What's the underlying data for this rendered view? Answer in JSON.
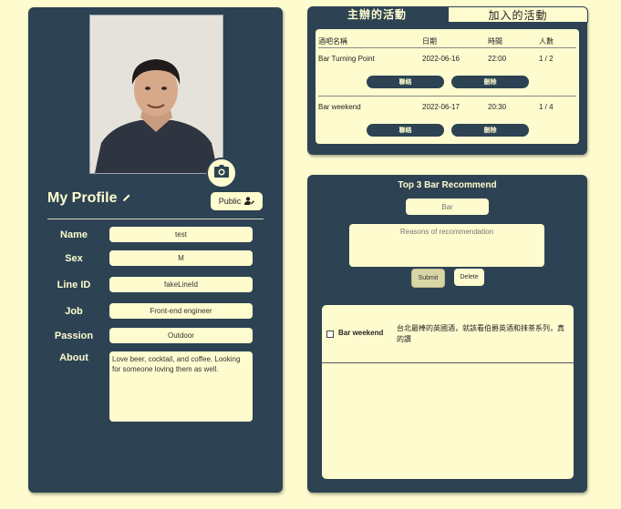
{
  "profile": {
    "title": "My Profile",
    "visibility_label": "Public",
    "fields": [
      {
        "label": "Name",
        "value": "test"
      },
      {
        "label": "Sex",
        "value": "M"
      },
      {
        "label": "Line ID",
        "value": "fakeLineId"
      },
      {
        "label": "Job",
        "value": "Front-end engineer"
      },
      {
        "label": "Passion",
        "value": "Outdoor"
      }
    ],
    "about_label": "About",
    "about_value": "Love beer, cocktail, and coffee. Looking for someone loving them as well.",
    "icons": {
      "edit": "pencil-icon",
      "camera": "camera-icon",
      "visibility": "user-edit-icon"
    }
  },
  "events": {
    "tabs": [
      {
        "label": "主辦的活動",
        "active": true
      },
      {
        "label": "加入的活動",
        "active": false
      }
    ],
    "columns": [
      "酒吧名稱",
      "日期",
      "時間",
      "人數"
    ],
    "rows": [
      {
        "name": "Bar Turning Point",
        "date": "2022-06-16",
        "time": "22:00",
        "count": "1 / 2",
        "contact_label": "聯絡",
        "delete_label": "刪除"
      },
      {
        "name": "Bar weekend",
        "date": "2022-06-17",
        "time": "20:30",
        "count": "1 / 4",
        "contact_label": "聯絡",
        "delete_label": "刪除"
      }
    ]
  },
  "recommend": {
    "title": "Top 3 Bar Recommend",
    "bar_placeholder": "Bar",
    "reasons_placeholder": "Reasons of recommendation",
    "submit_label": "Submit",
    "delete_label": "Delete",
    "items": [
      {
        "name": "Bar weekend",
        "reason": "台北最棒的英國酒，就該看伯爵英酒和抹茶系列，真的讚"
      }
    ]
  },
  "colors": {
    "panel": "#2d4353",
    "background": "#fefccf",
    "accent_button": "#d9d6a6"
  }
}
